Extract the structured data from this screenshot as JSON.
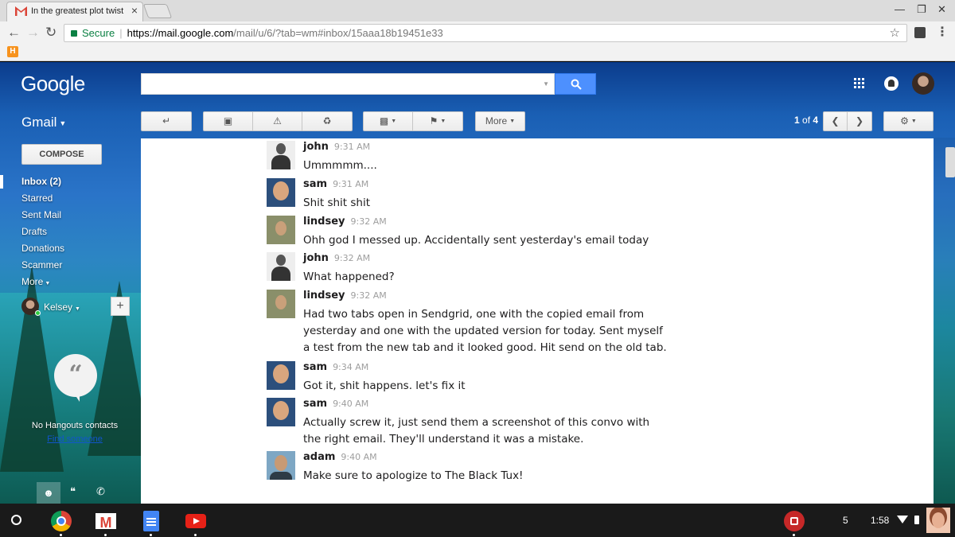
{
  "browser": {
    "tab_title": "In the greatest plot twist",
    "tab_close": "×",
    "secure_label": "Secure",
    "url_host": "https://mail.google.com",
    "url_path": "/mail/u/6/?tab=wm#inbox/15aaa18b19451e33",
    "bookmark_label": "H"
  },
  "gmail": {
    "logo": "Google",
    "app_label": "Gmail",
    "compose_label": "COMPOSE",
    "nav": [
      {
        "label": "Inbox (2)"
      },
      {
        "label": "Starred"
      },
      {
        "label": "Sent Mail"
      },
      {
        "label": "Drafts"
      },
      {
        "label": "Donations"
      },
      {
        "label": "Scammer"
      },
      {
        "label": "More"
      }
    ],
    "user_name": "Kelsey",
    "add_label": "+",
    "no_contacts": "No Hangouts contacts",
    "find_someone": "Find someone",
    "toolbar": {
      "more_label": "More"
    },
    "pager": {
      "current": "1",
      "of": "of",
      "total": "4"
    }
  },
  "messages": [
    {
      "user": "john",
      "time": "9:31 AM",
      "text": "Ummmmm...."
    },
    {
      "user": "sam",
      "time": "9:31 AM",
      "text": "Shit shit shit"
    },
    {
      "user": "lindsey",
      "time": "9:32 AM",
      "text": "Ohh god I messed up. Accidentally sent yesterday's email today"
    },
    {
      "user": "john",
      "time": "9:32 AM",
      "text": "What happened?"
    },
    {
      "user": "lindsey",
      "time": "9:32 AM",
      "text": "Had two tabs open in Sendgrid, one with the copied email from yesterday and one with the updated version for today. Sent myself a test from the new tab and it looked good. Hit send on the old tab."
    },
    {
      "user": "sam",
      "time": "9:34 AM",
      "text": "Got it, shit happens. let's fix it"
    },
    {
      "user": "sam",
      "time": "9:40 AM",
      "text": "Actually screw it, just send them a screenshot of this convo with the right email. They'll understand it was a mistake."
    },
    {
      "user": "adam",
      "time": "9:40 AM",
      "text": "Make sure to apologize to The Black Tux!"
    }
  ],
  "shelf": {
    "notification_count": "5",
    "clock": "1:58"
  }
}
